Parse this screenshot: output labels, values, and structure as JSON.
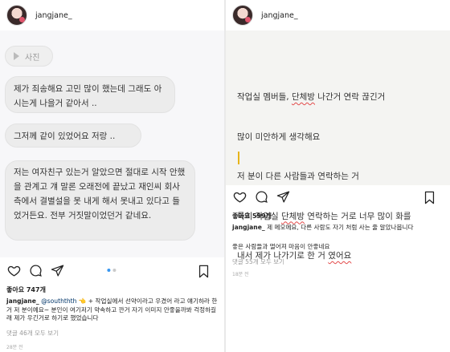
{
  "left": {
    "username": "jangjane_",
    "photo_label": "사진",
    "messages": [
      "제가 죄송해요 고민 많이 했는데  그래도 아시는게 나을거 같아서 ..",
      "그저께 같이 있었어요 저랑  ..",
      "저는 여자친구 있는거 알았으면 절대로 시작 안했을 관계고 걔 말론 오래전에 끝났고 재인씨 회사측에서 결별설을 못 내게 해서 못내고 있다고 들었거든요. 전부 거짓말이었던거 같네요."
    ],
    "likes": "좋아요 747개",
    "caption_user": "jangjane_",
    "caption_mention": "@souththth",
    "caption_body": " 👈 + 작업실에서 선약이라고 우겼어 라고 얘기하라 한거 저 분이예요~ 분인이 여기저기 약속하고 깐거 자기 이미지 안좋을까봐 걱정하길래 제가 우긴거로 하기로 했었습니다",
    "comments": "댓글 46개 모두 보기",
    "time": "28분 전"
  },
  "right": {
    "username": "jangjane_",
    "note_lines": [
      [
        "작업실 멤버들, ",
        "단체방",
        " 나간거 연락 끊긴거"
      ],
      [
        "많이 미안하게 생각해요",
        "",
        ""
      ],
      [
        "저 분이 다른 사람들과 연락하는 거",
        "",
        ""
      ],
      [
        "특히 작업실 ",
        "단체방",
        " 연락하는 거로 너무 많이 화를"
      ],
      [
        "내서 제가 나가기로 한 거 ",
        "였어요",
        ""
      ]
    ],
    "likes": "좋아요 599개",
    "caption_user": "jangjane_",
    "caption_body": " 제 메모에요, 다른 사람도 자기 처럼 사는 줄 알았나봅니다",
    "caption_line2": "좋은 사람들과 멀어져 마음이 안좋네요",
    "comments": "댓글 55개 모두 보기",
    "time": "18분 전"
  }
}
